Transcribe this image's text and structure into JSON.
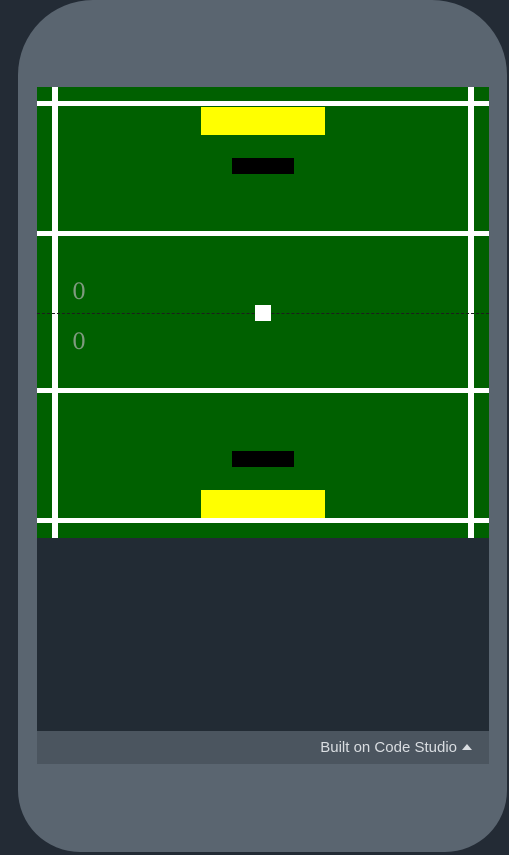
{
  "game": {
    "score_top": "0",
    "score_bottom": "0",
    "colors": {
      "field": "#006000",
      "lines": "#ffffff",
      "goals": "#ffff00",
      "paddles": "#000000",
      "ball": "#ffffff"
    }
  },
  "footer": {
    "label": "Built on Code Studio",
    "icon": "triangle-up-icon"
  }
}
